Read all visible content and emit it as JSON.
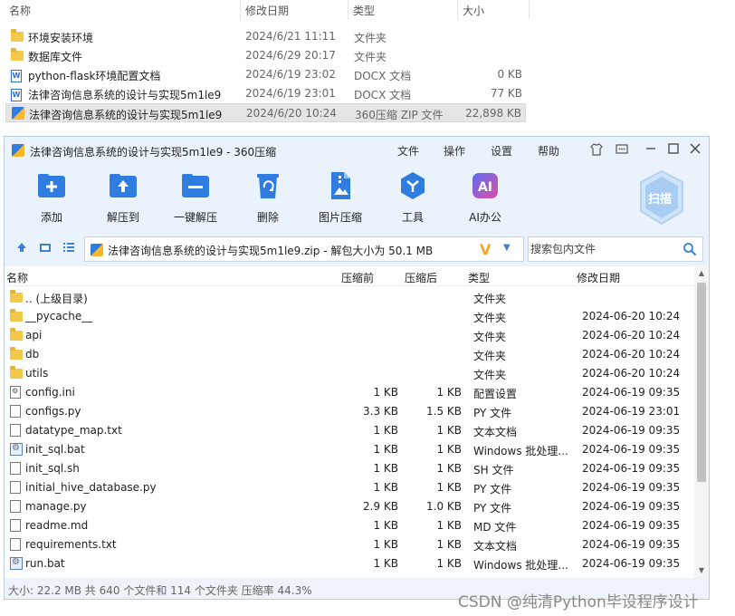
{
  "explorer": {
    "headers": {
      "name": "名称",
      "modified": "修改日期",
      "type": "类型",
      "size": "大小"
    },
    "rows": [
      {
        "name": "环境安装环境",
        "date": "2024/6/21 11:11",
        "type": "文件夹",
        "size": "",
        "icon": "folder-icon"
      },
      {
        "name": "数据库文件",
        "date": "2024/6/29 20:17",
        "type": "文件夹",
        "size": "",
        "icon": "folder-icon"
      },
      {
        "name": "python-flask环境配置文档",
        "date": "2024/6/19 23:02",
        "type": "DOCX 文档",
        "size": "0 KB",
        "icon": "docx-icon"
      },
      {
        "name": "法律咨询信息系统的设计与实现5m1le9",
        "date": "2024/6/19 23:01",
        "type": "DOCX 文档",
        "size": "77 KB",
        "icon": "docx-icon"
      },
      {
        "name": "法律咨询信息系统的设计与实现5m1le9",
        "date": "2024/6/20 10:24",
        "type": "360压缩 ZIP 文件",
        "size": "22,898 KB",
        "icon": "zip-icon",
        "selected": true
      }
    ]
  },
  "window": {
    "title": "法律咨询信息系统的设计与实现5m1le9 - 360压缩",
    "menu": {
      "file": "文件",
      "operate": "操作",
      "settings": "设置",
      "help": "帮助"
    },
    "toolbar": {
      "add": "添加",
      "extract_to": "解压到",
      "one_click": "一键解压",
      "delete": "删除",
      "image_compress": "图片压缩",
      "tools": "工具",
      "ai_office": "AI办公",
      "scan": "扫描"
    },
    "address": {
      "path": "法律咨询信息系统的设计与实现5m1le9.zip - 解包大小为 50.1 MB",
      "search_placeholder": "搜索包内文件"
    },
    "list_headers": {
      "name": "名称",
      "compressed": "压缩前",
      "original": "压缩后",
      "type": "类型",
      "modified": "修改日期"
    },
    "files": [
      {
        "name": ".. (上级目录)",
        "cs": "",
        "os": "",
        "type": "文件夹",
        "date": "",
        "icon": "folder-icon"
      },
      {
        "name": "__pycache__",
        "cs": "",
        "os": "",
        "type": "文件夹",
        "date": "2024-06-20 10:24",
        "icon": "folder-icon"
      },
      {
        "name": "api",
        "cs": "",
        "os": "",
        "type": "文件夹",
        "date": "2024-06-20 10:24",
        "icon": "folder-icon"
      },
      {
        "name": "db",
        "cs": "",
        "os": "",
        "type": "文件夹",
        "date": "2024-06-20 10:24",
        "icon": "folder-icon"
      },
      {
        "name": "utils",
        "cs": "",
        "os": "",
        "type": "文件夹",
        "date": "2024-06-20 10:24",
        "icon": "folder-icon"
      },
      {
        "name": "config.ini",
        "cs": "1 KB",
        "os": "1 KB",
        "type": "配置设置",
        "date": "2024-06-19 09:35",
        "icon": "config-file-icon"
      },
      {
        "name": "configs.py",
        "cs": "3.3 KB",
        "os": "1.5 KB",
        "type": "PY 文件",
        "date": "2024-06-19 23:01",
        "icon": "file-icon"
      },
      {
        "name": "datatype_map.txt",
        "cs": "1 KB",
        "os": "1 KB",
        "type": "文本文档",
        "date": "2024-06-19 09:35",
        "icon": "file-icon"
      },
      {
        "name": "init_sql.bat",
        "cs": "1 KB",
        "os": "1 KB",
        "type": "Windows 批处理...",
        "date": "2024-06-19 09:35",
        "icon": "bat-file-icon"
      },
      {
        "name": "init_sql.sh",
        "cs": "1 KB",
        "os": "1 KB",
        "type": "SH 文件",
        "date": "2024-06-19 09:35",
        "icon": "file-icon"
      },
      {
        "name": "initial_hive_database.py",
        "cs": "1 KB",
        "os": "1 KB",
        "type": "PY 文件",
        "date": "2024-06-19 09:35",
        "icon": "file-icon"
      },
      {
        "name": "manage.py",
        "cs": "2.9 KB",
        "os": "1.0 KB",
        "type": "PY 文件",
        "date": "2024-06-19 09:35",
        "icon": "file-icon"
      },
      {
        "name": "readme.md",
        "cs": "1 KB",
        "os": "1 KB",
        "type": "MD 文件",
        "date": "2024-06-19 09:35",
        "icon": "file-icon"
      },
      {
        "name": "requirements.txt",
        "cs": "1 KB",
        "os": "1 KB",
        "type": "文本文档",
        "date": "2024-06-19 09:35",
        "icon": "file-icon"
      },
      {
        "name": "run.bat",
        "cs": "1 KB",
        "os": "1 KB",
        "type": "Windows 批处理...",
        "date": "2024-06-19 09:35",
        "icon": "bat-file-icon"
      }
    ],
    "status": "大小: 22.2 MB 共 640 个文件和 114 个文件夹 压缩率 44.3%"
  },
  "watermark": "CSDN @纯清Python毕设程序设计",
  "colors": {
    "window_bg": "#eaf2fb",
    "accent": "#2f7de1",
    "folder": "#f2c94c"
  }
}
